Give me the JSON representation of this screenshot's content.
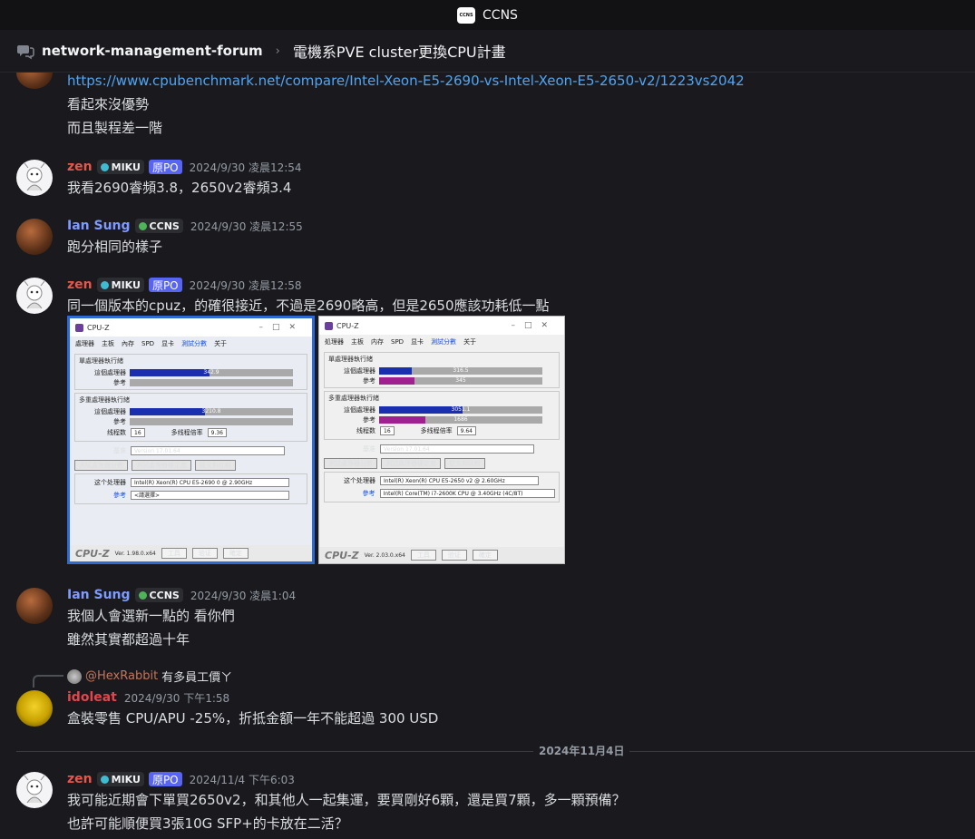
{
  "app": {
    "title": "CCNS",
    "logo_text": "CCNS"
  },
  "header": {
    "channel": "network-management-forum",
    "separator": "›",
    "thread": "電機系PVE cluster更換CPU計畫"
  },
  "colors": {
    "zen": "#e5564b",
    "ian": "#7e9bff",
    "idoleat": "#e0474d",
    "miku_tag": "#3dbcd2",
    "ccns_tag": "#4fb35a",
    "link": "#4ea5f5"
  },
  "messages": [
    {
      "lines": [
        "https://www.cpubenchmark.net/compare/Intel-Xeon-E5-2690-vs-Intel-Xeon-E5-2650-v2/1223vs2042",
        "看起來沒優勢",
        "而且製程差一階"
      ]
    },
    {
      "author": "zen",
      "tag": "MIKU",
      "op": "原PO",
      "time": "2024/9/30 凌晨12:54",
      "lines": [
        "我看2690睿頻3.8，2650v2睿頻3.4"
      ]
    },
    {
      "author": "Ian Sung",
      "tag": "CCNS",
      "time": "2024/9/30 凌晨12:55",
      "lines": [
        "跑分相同的樣子"
      ]
    },
    {
      "author": "zen",
      "tag": "MIKU",
      "op": "原PO",
      "time": "2024/9/30 凌晨12:58",
      "lines": [
        "同一個版本的cpuz，的確很接近，不過是2690略高，但是2650應該功耗低一點"
      ]
    },
    {
      "author": "Ian Sung",
      "tag": "CCNS",
      "time": "2024/9/30 凌晨1:04",
      "lines": [
        "我個人會選新一點的 看你們",
        "雖然其實都超過十年"
      ]
    },
    {
      "author": "idoleat",
      "time": "2024/9/30 下午1:58",
      "lines": [
        "盒裝零售 CPU/APU -25%，折抵金額一年不能超過 300 USD"
      ],
      "reply": {
        "name": "@HexRabbit",
        "text": "有多員工價ㄚ"
      }
    },
    {
      "author": "zen",
      "tag": "MIKU",
      "op": "原PO",
      "time": "2024/11/4 下午6:03",
      "lines": [
        "我可能近期會下單買2650v2，和其他人一起集運，要買剛好6顆，還是買7顆，多一顆預備？",
        "也許可能順便買3張10G SFP+的卡放在二活？"
      ]
    }
  ],
  "divider": "2024年11月4日",
  "cpuz": [
    {
      "title": "CPU-Z",
      "tabs": [
        "處理器",
        "主板",
        "內存",
        "SPD",
        "显卡",
        "測試分數",
        "关于"
      ],
      "single_title": "單處理器執行緒",
      "multi_title": "多重處理器執行緒",
      "this_cpu": "這個處理器",
      "ref": "參考",
      "threads_label": "线程数",
      "threads_value": "16",
      "ratio_label": "多线程倍率",
      "ratio_value": "9.36",
      "single": 342.9,
      "single_text": "342.9",
      "multi": 3210.8,
      "multi_text": "3210.8",
      "single_max": 700,
      "multi_max": 7000,
      "bench_label": "基准",
      "bench_value": "Version 17.01.64",
      "buttons": [
        "測試處理器分數",
        "測試處理器穩定度",
        "提交和比較"
      ],
      "cpu_label": "这个处理器",
      "cpu_value": "Intel(R) Xeon(R) CPU E5-2690 0 @ 2.90GHz",
      "ref_label": "參考",
      "ref_value": "<請選擇>",
      "version": "Ver. 1.98.0.x64",
      "footer_buttons": [
        "工具",
        "验证",
        "確定"
      ]
    },
    {
      "title": "CPU-Z",
      "tabs": [
        "処理器",
        "主板",
        "内存",
        "SPD",
        "显卡",
        "測試分數",
        "关于"
      ],
      "single_title": "單處理器執行緒",
      "multi_title": "多重處理器執行緒",
      "this_cpu": "這個處理器",
      "ref": "參考",
      "threads_label": "线程数",
      "threads_value": "16",
      "ratio_label": "多线程倍率",
      "ratio_value": "9.64",
      "single": 316.5,
      "single_text": "316.5",
      "single_ref": 345,
      "single_ref_text": "345",
      "multi": 3051.1,
      "multi_text": "3051.1",
      "multi_ref": 1686,
      "multi_ref_text": "1686",
      "single_max": 1600,
      "multi_max": 6000,
      "bench_label": "基准",
      "bench_value": "Version 17.01.64",
      "buttons": [
        "測試處理器分數",
        "測試處理器穩定度",
        "提交和比較"
      ],
      "cpu_label": "这个处理器",
      "cpu_value": "Intel(R) Xeon(R) CPU E5-2650 v2 @ 2.60GHz",
      "ref_label": "參考",
      "ref_value": "Intel(R) Core(TM) i7-2600K CPU @ 3.40GHz (4C/8T)",
      "version": "Ver. 2.03.0.x64",
      "footer_buttons": [
        "工具",
        "验证",
        "確定"
      ]
    }
  ]
}
